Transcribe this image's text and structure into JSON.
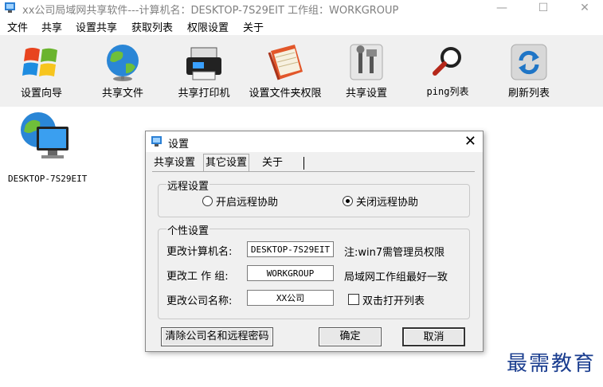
{
  "window": {
    "title": "xx公司局域网共享软件---计算机名：DESKTOP-7S29EIT   工作组：WORKGROUP",
    "minimize": "—",
    "maximize": "☐",
    "close": "✕"
  },
  "menu": [
    "文件",
    "共享",
    "设置共享",
    "获取列表",
    "权限设置",
    "关于"
  ],
  "toolbar": [
    {
      "label": "设置向导",
      "icon": "windows-logo-icon"
    },
    {
      "label": "共享文件",
      "icon": "globe-icon"
    },
    {
      "label": "共享打印机",
      "icon": "printer-icon"
    },
    {
      "label": "设置文件夹权限",
      "icon": "folder-icon"
    },
    {
      "label": "共享设置",
      "icon": "tools-icon"
    },
    {
      "label": "ping列表",
      "icon": "magnifier-icon"
    },
    {
      "label": "刷新列表",
      "icon": "refresh-icon"
    }
  ],
  "computers": [
    {
      "name": "DESKTOP-7S29EIT",
      "icon": "networked-computer-icon"
    }
  ],
  "dialog": {
    "title": "设置",
    "close": "✕",
    "tabs": [
      "共享设置",
      "其它设置",
      "关于"
    ],
    "active_tab": 1,
    "remote": {
      "title": "远程设置",
      "enable_label": "开启远程协助",
      "disable_label": "关闭远程协助",
      "selected": "disable"
    },
    "personal": {
      "title": "个性设置",
      "computer_name_label": "更改计算机名:",
      "computer_name_value": "DESKTOP-7S29EIT",
      "computer_name_note": "注:win7需管理员权限",
      "workgroup_label": "更改工 作 组:",
      "workgroup_value": "WORKGROUP",
      "workgroup_note": "局域网工作组最好一致",
      "company_label": "更改公司名称:",
      "company_value": "XX公司",
      "dblclick_label": "双击打开列表",
      "dblclick_checked": false
    },
    "buttons": {
      "clear": "清除公司名和远程密码",
      "ok": "确定",
      "cancel": "取消"
    }
  },
  "watermark": "最需教育",
  "colors": {
    "toolbar_bg": "#f0f0f0",
    "watermark": "#1a3d8f"
  }
}
